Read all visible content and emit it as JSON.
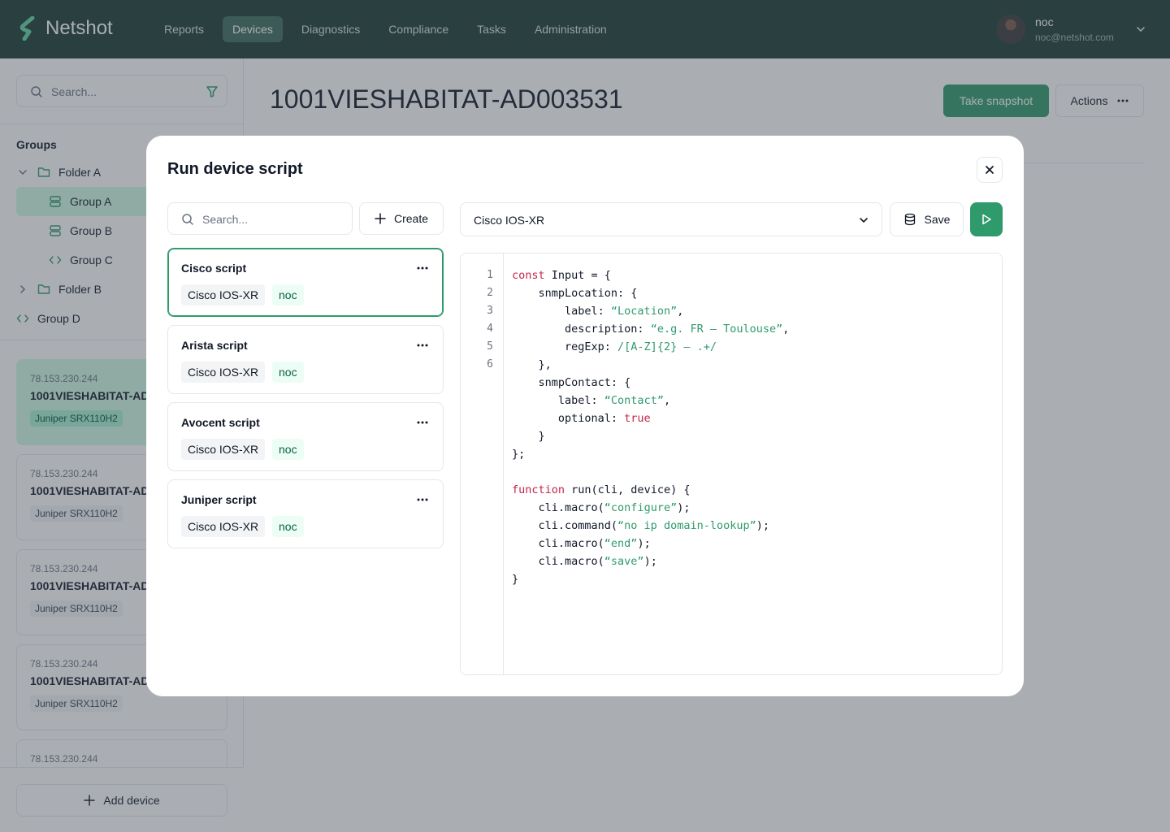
{
  "app": {
    "name": "Netshot"
  },
  "nav": {
    "items": [
      "Reports",
      "Devices",
      "Diagnostics",
      "Compliance",
      "Tasks",
      "Administration"
    ],
    "active": "Devices"
  },
  "user": {
    "name": "noc",
    "email": "noc@netshot.com"
  },
  "sidebar": {
    "search_placeholder": "Search...",
    "groups_title": "Groups",
    "tree": [
      {
        "label": "Folder A",
        "type": "folder",
        "expanded": true
      },
      {
        "label": "Group A",
        "type": "static-group",
        "selected": true
      },
      {
        "label": "Group B",
        "type": "static-group"
      },
      {
        "label": "Group C",
        "type": "dynamic-group"
      },
      {
        "label": "Folder B",
        "type": "folder",
        "expanded": false
      },
      {
        "label": "Group D",
        "type": "dynamic-group"
      }
    ],
    "devices": [
      {
        "ip": "78.153.230.244",
        "name": "1001VIESHABITAT-AD",
        "model": "Juniper SRX110H2",
        "selected": true
      },
      {
        "ip": "78.153.230.244",
        "name": "1001VIESHABITAT-AD",
        "model": "Juniper SRX110H2"
      },
      {
        "ip": "78.153.230.244",
        "name": "1001VIESHABITAT-AD",
        "model": "Juniper SRX110H2"
      },
      {
        "ip": "78.153.230.244",
        "name": "1001VIESHABITAT-AD",
        "model": "Juniper SRX110H2"
      },
      {
        "ip": "78.153.230.244"
      }
    ],
    "add_device_label": "Add device"
  },
  "page": {
    "title": "1001VIESHABITAT-AD003531",
    "take_snapshot_label": "Take snapshot",
    "actions_label": "Actions"
  },
  "modal": {
    "title": "Run device script",
    "search_placeholder": "Search...",
    "create_label": "Create",
    "scripts": [
      {
        "name": "Cisco script",
        "os": "Cisco IOS-XR",
        "user": "noc",
        "selected": true
      },
      {
        "name": "Arista script",
        "os": "Cisco IOS-XR",
        "user": "noc"
      },
      {
        "name": "Avocent script",
        "os": "Cisco IOS-XR",
        "user": "noc"
      },
      {
        "name": "Juniper script",
        "os": "Cisco IOS-XR",
        "user": "noc"
      }
    ],
    "os_selected": "Cisco IOS-XR",
    "save_label": "Save",
    "editor": {
      "line_numbers": [
        "1",
        "2",
        "3",
        "4",
        "5",
        "6"
      ],
      "code": [
        [
          [
            "kw",
            "const"
          ],
          [
            "",
            " Input = {"
          ]
        ],
        [
          [
            "",
            "    snmpLocation: {"
          ]
        ],
        [
          [
            "",
            "        label: "
          ],
          [
            "str",
            "“Location”"
          ],
          [
            "",
            ","
          ]
        ],
        [
          [
            "",
            "        description: "
          ],
          [
            "str",
            "“e.g. FR – Toulouse”"
          ],
          [
            "",
            ","
          ]
        ],
        [
          [
            "",
            "        regExp: "
          ],
          [
            "str",
            "/[A-Z]{2} – .+/"
          ]
        ],
        [
          [
            "",
            "    },"
          ]
        ],
        [
          [
            "",
            "    snmpContact: {"
          ]
        ],
        [
          [
            "",
            "       label: "
          ],
          [
            "str",
            "“Contact”"
          ],
          [
            "",
            ","
          ]
        ],
        [
          [
            "",
            "       optional: "
          ],
          [
            "kw",
            "true"
          ]
        ],
        [
          [
            "",
            "    }"
          ]
        ],
        [
          [
            "",
            "};"
          ]
        ],
        [
          [
            "",
            ""
          ]
        ],
        [
          [
            "kw",
            "function"
          ],
          [
            "",
            " run(cli, device) {"
          ]
        ],
        [
          [
            "",
            "    cli.macro("
          ],
          [
            "str",
            "“configure”"
          ],
          [
            "",
            ");"
          ]
        ],
        [
          [
            "",
            "    cli.command("
          ],
          [
            "str",
            "“no ip domain-lookup”"
          ],
          [
            "",
            ");"
          ]
        ],
        [
          [
            "",
            "    cli.macro("
          ],
          [
            "str",
            "“end”"
          ],
          [
            "",
            ");"
          ]
        ],
        [
          [
            "",
            "    cli.macro("
          ],
          [
            "str",
            "“save”"
          ],
          [
            "",
            ");"
          ]
        ],
        [
          [
            "",
            "}"
          ]
        ]
      ]
    }
  },
  "colors": {
    "topbar": "#1b3b32",
    "accent": "#2f9a6c",
    "keyword": "#c2264b",
    "string": "#2f9a6c"
  }
}
